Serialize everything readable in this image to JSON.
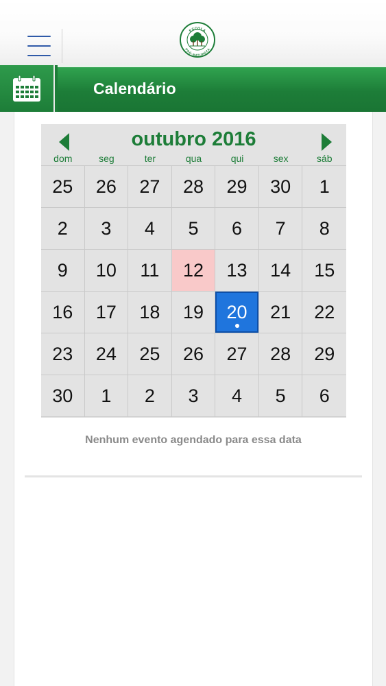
{
  "header": {
    "title": "Calendário"
  },
  "logo": {
    "text_top": "ESCOLA",
    "text_bottom": "PRÓ-NATUREZA"
  },
  "calendar": {
    "month_label": "outubro 2016",
    "weekdays": [
      "dom",
      "seg",
      "ter",
      "qua",
      "qui",
      "sex",
      "sáb"
    ],
    "days": [
      "25",
      "26",
      "27",
      "28",
      "29",
      "30",
      "1",
      "2",
      "3",
      "4",
      "5",
      "6",
      "7",
      "8",
      "9",
      "10",
      "11",
      "12",
      "13",
      "14",
      "15",
      "16",
      "17",
      "18",
      "19",
      "20",
      "21",
      "22",
      "23",
      "24",
      "25",
      "26",
      "27",
      "28",
      "29",
      "30",
      "1",
      "2",
      "3",
      "4",
      "5",
      "6"
    ],
    "today_index": 17,
    "selected_index": 25,
    "event_dot_index": 25
  },
  "events": {
    "empty_message": "Nenhum evento agendado para essa data"
  },
  "colors": {
    "brand_green": "#1d7d38",
    "selected_blue": "#1f75dd",
    "today_pink": "#f9c9c9",
    "menu_blue": "#2f5aa8"
  }
}
